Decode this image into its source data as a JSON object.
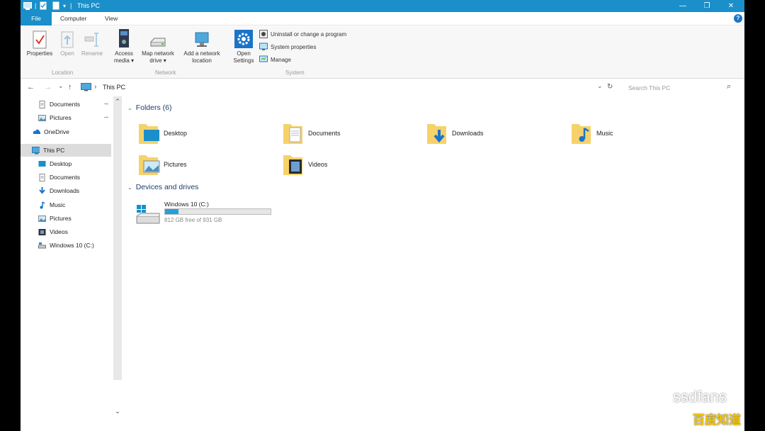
{
  "window": {
    "title": "This PC",
    "controls": {
      "minimize": "—",
      "maximize": "❐",
      "close": "✕"
    }
  },
  "ribbon_tabs": {
    "file": "File",
    "computer": "Computer",
    "view": "View",
    "help": "?"
  },
  "ribbon": {
    "location": {
      "label": "Location",
      "properties": "Properties",
      "open": "Open",
      "rename": "Rename"
    },
    "network": {
      "label": "Network",
      "access_media_1": "Access",
      "access_media_2": "media ▾",
      "map_drive_1": "Map network",
      "map_drive_2": "drive ▾",
      "add_location_1": "Add a network",
      "add_location_2": "location"
    },
    "system": {
      "label": "System",
      "open_settings_1": "Open",
      "open_settings_2": "Settings",
      "uninstall": "Uninstall or change a program",
      "system_properties": "System properties",
      "manage": "Manage"
    }
  },
  "address": {
    "back": "←",
    "forward": "→",
    "recent": "⌄",
    "up": "↑",
    "separator": "›",
    "path": "This PC",
    "dropdown": "⌄",
    "refresh": "↻",
    "search_placeholder": "Search This PC",
    "search_icon": "⌕"
  },
  "nav_pane": {
    "quick_access": [
      {
        "label": "Documents",
        "pinned": "📌"
      },
      {
        "label": "Pictures",
        "pinned": "📌"
      }
    ],
    "onedrive": "OneDrive",
    "this_pc": "This PC",
    "this_pc_children": [
      "Desktop",
      "Documents",
      "Downloads",
      "Music",
      "Pictures",
      "Videos",
      "Windows 10 (C:)"
    ],
    "scroll_up": "⌃",
    "scroll_down": "⌄"
  },
  "content": {
    "folders_header": "Folders (6)",
    "folders": [
      "Desktop",
      "Documents",
      "Downloads",
      "Music",
      "Pictures",
      "Videos"
    ],
    "devices_header": "Devices and drives",
    "drives": [
      {
        "name": "Windows 10 (C:)",
        "free_text": "812 GB free of 931 GB",
        "used_fraction": 0.128
      }
    ]
  },
  "watermark": {
    "brand": "ssdfans",
    "site": "百度知道"
  },
  "colors": {
    "accent": "#1a8fc9",
    "drive_bar": "#26a0da",
    "folder": "#f6d26b"
  }
}
